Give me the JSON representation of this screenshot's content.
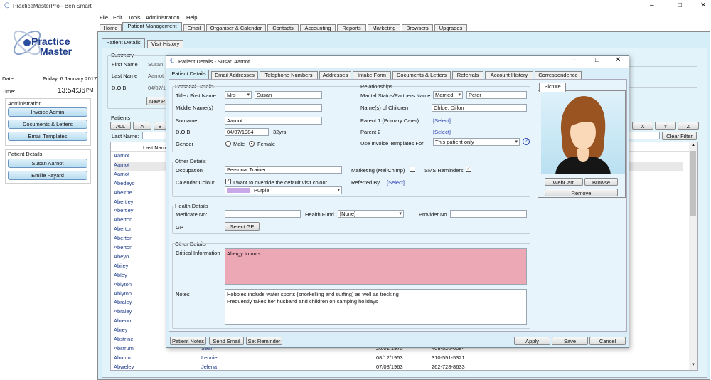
{
  "window": {
    "title": "PracticeMasterPro - Ben Smart"
  },
  "menu": [
    "File",
    "Edit",
    "Tools",
    "Administration",
    "Help"
  ],
  "main_tabs": [
    "Home",
    "Patient Management",
    "Email",
    "Organiser & Calendar",
    "Contacts",
    "Accounting",
    "Reports",
    "Marketing",
    "Browsers",
    "Upgrades"
  ],
  "logo": {
    "line1": "Practice",
    "line2": "Master"
  },
  "left": {
    "date_label": "Date:",
    "date": "Friday, 6 January 2017",
    "time_label": "Time:",
    "time": "13:54:36",
    "ampm": "PM",
    "admin_title": "Administration",
    "admin_buttons": [
      "Invoice Admin",
      "Documents & Letters",
      "Email Templates"
    ],
    "pd_title": "Patient Details",
    "pd_buttons": [
      "Susan Aarnot",
      "Emilie Fayard"
    ]
  },
  "bg": {
    "subtabs": [
      "Patient Details",
      "Visit History"
    ],
    "summary": "Summary",
    "first_name_label": "First Name",
    "first_name": "Susan",
    "last_name_label": "Last Name",
    "last_name": "Aarnot",
    "dob_label": "D.O.B.",
    "dob": "04/07/1",
    "new_btn": "New P",
    "patients_label": "Patients",
    "alpha": [
      "ALL",
      "A",
      "B"
    ],
    "alpha_right": [
      "X",
      "Y",
      "Z"
    ],
    "lastname_label": "Last Name:",
    "clear_filter": "Clear Filter",
    "col_last": "Last Name",
    "names": [
      "Aarnot",
      "Aarnot",
      "Aarnot",
      "Abedeyo",
      "Abeirne",
      "Abertley",
      "Abertley",
      "Aberton",
      "Aberton",
      "Aberton",
      "Aberton",
      "Abeyo",
      "Abiley",
      "Abley",
      "Ablyton",
      "Ablyton",
      "Abraley",
      "Abraley",
      "Abrenn",
      "Abrey",
      "Abstrine",
      "Abstrum",
      "Abuntu",
      "Abweley"
    ],
    "extra_rows": [
      {
        "first": "Sean",
        "dob": "20/01/1970",
        "phone": "408-520-0084"
      },
      {
        "first": "Leonie",
        "dob": "08/12/1953",
        "phone": "310-551-5321"
      },
      {
        "first": "Jelena",
        "dob": "07/08/1963",
        "phone": "262-728-8633"
      }
    ]
  },
  "dialog": {
    "title": "Patient Details - Susan Aarnot",
    "tabs": [
      "Patient Details",
      "Email Addresses",
      "Telephone Numbers",
      "Addresses",
      "Intake Form",
      "Documents & Letters",
      "Referrals",
      "Account History",
      "Correspondence"
    ],
    "personal": {
      "title": "Personal Details",
      "title_label": "Title / First Name",
      "title_val": "Mrs",
      "first": "Susan",
      "middle_label": "Middle Name(s)",
      "surname_label": "Surname",
      "surname": "Aarnot",
      "dob_label": "D.O.B",
      "dob": "04/07/1984",
      "age": "32yrs",
      "gender_label": "Gender",
      "male": "Male",
      "female": "Female"
    },
    "relationships": {
      "title": "Relationships",
      "marital_label": "Marital Status/Partners Name",
      "marital": "Married",
      "partner": "Peter",
      "children_label": "Name(s) of Children",
      "children": "Chloe, Dillon",
      "parent1_label": "Parent 1 (Primary Carer)",
      "parent2_label": "Parent 2",
      "select": "[Select]",
      "invoice_label": "Use Invoice Templates For",
      "invoice": "This patient only",
      "help": "?"
    },
    "picture": {
      "tab": "Picture",
      "webcam": "WebCam",
      "browse": "Browse",
      "remove": "Remove"
    },
    "other": {
      "title": "Other Details",
      "occupation_label": "Occupation",
      "occupation": "Personal Trainer",
      "marketing_label": "Marketing (MailChimp)",
      "sms_label": "SMS Reminders",
      "calendar_label": "Calendar Colour",
      "override": "I want to override the default visit colour",
      "colour": "Purple",
      "referred_label": "Referred By",
      "select": "[Select]"
    },
    "health": {
      "title": "Health Details",
      "medicare_label": "Medicare No:",
      "fund_label": "Health Fund",
      "fund": "[None]",
      "provider_label": "Provider No",
      "gp_label": "GP",
      "select_gp": "Select GP"
    },
    "other2": {
      "title": "Other Details",
      "critical_label": "Critical Information",
      "critical": "Allergy to nuts",
      "notes_label": "Notes",
      "notes1": "Hobbies include water sports (snorkelling and surfing) as well as trecking",
      "notes2": "Frequently takes her husband and children on camping holidays"
    },
    "footer": {
      "notes": "Patient Notes",
      "email": "Send Email",
      "reminder": "Set Reminder",
      "apply": "Apply",
      "save": "Save",
      "cancel": "Cancel"
    }
  },
  "colors": {
    "accent": "#d6eef8",
    "critical": "#eda8b6",
    "purple": "#c9a8e8"
  }
}
